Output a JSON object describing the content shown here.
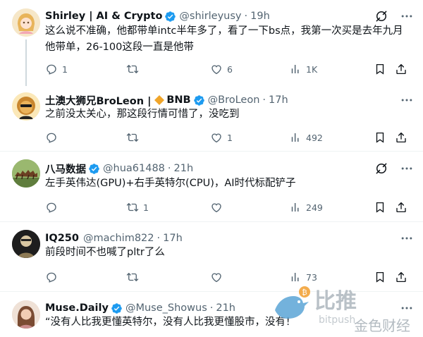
{
  "colors": {
    "accent": "#1d9bf0",
    "muted": "#536471",
    "text": "#0f1419",
    "divider": "#eff3f4"
  },
  "tweets": [
    {
      "name": "Shirley | AI & Crypto",
      "handle": "@shirleyusy",
      "time": "19h",
      "text": "这么说不准确，他都带单intc半年多了，看了一下bs点，我第一次买是去年九月他带单，26-100这段一直是他带",
      "actions": {
        "reply": "1",
        "retweet": "",
        "like": "6",
        "views": "1K"
      }
    },
    {
      "name": "土澳大狮兄BroLeon |",
      "badge_text": "BNB",
      "handle": "@BroLeon",
      "time": "17h",
      "text": "之前没太关心，那这段行情可惜了，没吃到",
      "actions": {
        "reply": "",
        "retweet": "",
        "like": "1",
        "views": "492"
      }
    },
    {
      "name": "八马数据",
      "handle": "@hua61488",
      "time": "21h",
      "text": "左手英伟达(GPU)+右手英特尔(CPU)，AI时代标配铲子",
      "actions": {
        "reply": "",
        "retweet": "1",
        "like": "",
        "views": "249"
      }
    },
    {
      "name": "IQ250",
      "handle": "@machim822",
      "time": "17h",
      "text": "前段时间不也喊了pltr了么",
      "actions": {
        "reply": "",
        "retweet": "",
        "like": "",
        "views": "73"
      }
    },
    {
      "name": "Muse.Daily",
      "handle": "@Muse_Showus",
      "time": "21h",
      "text": "“没有人比我更懂英特尔，没有人比我更懂股市，没有！"
    }
  ],
  "sep": "·",
  "watermark": {
    "cn": "比推",
    "sub": "bitpush",
    "logo_text": "金色财经"
  }
}
